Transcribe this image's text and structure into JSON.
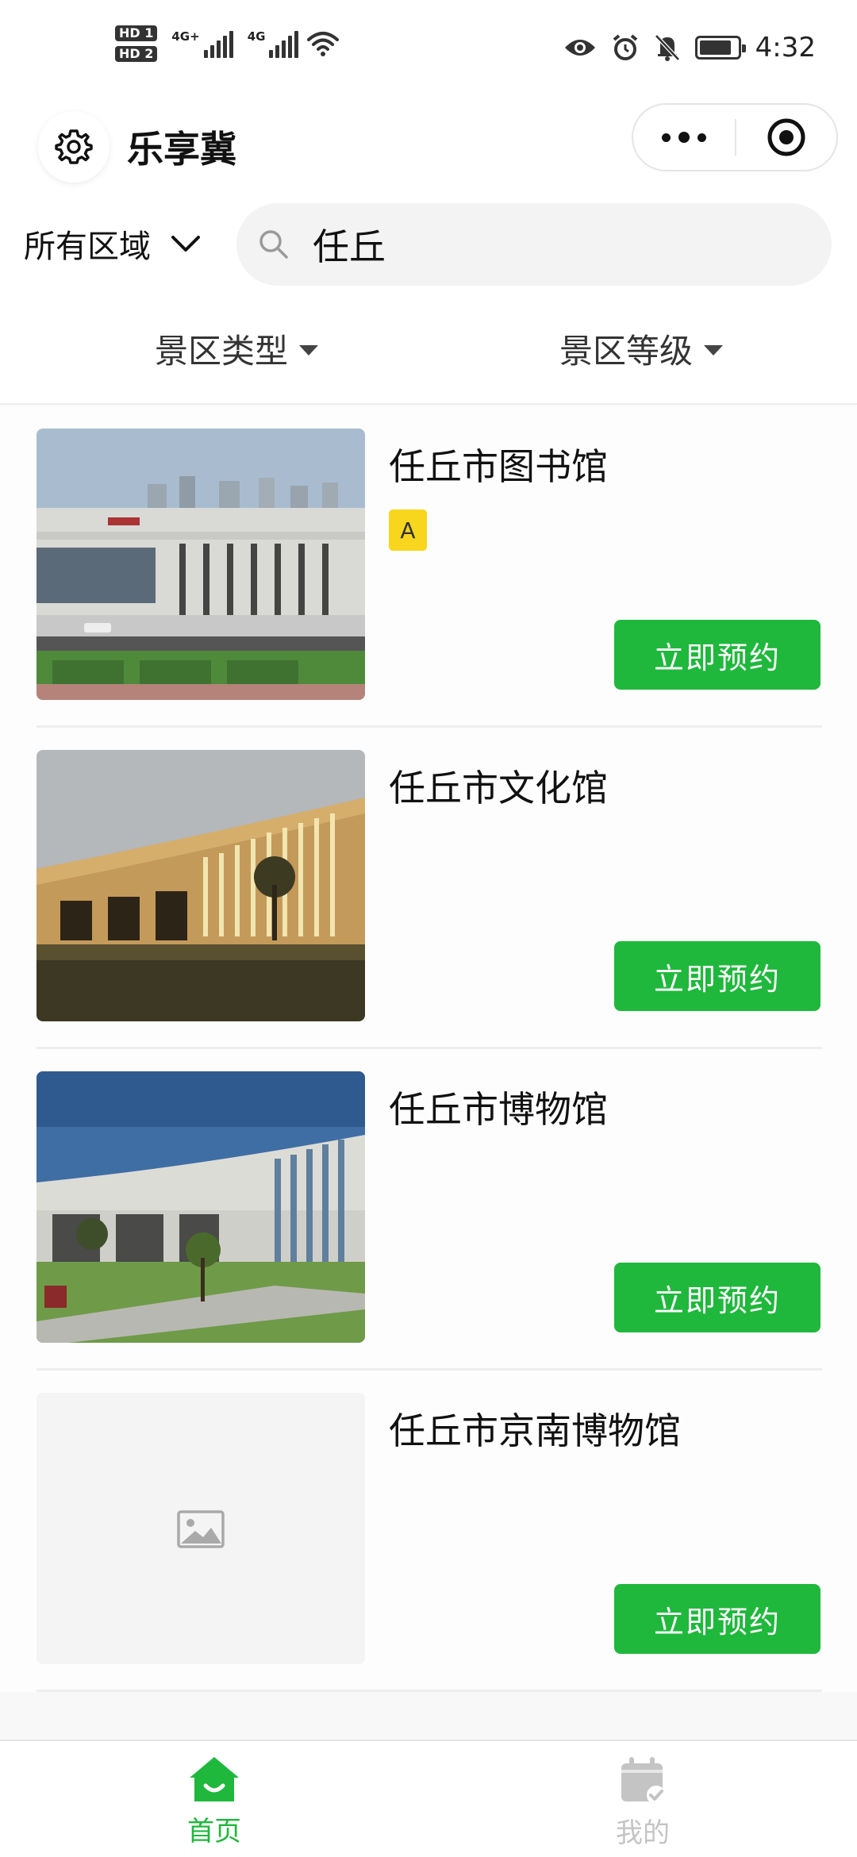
{
  "status_bar": {
    "hd1": "HD 1",
    "hd2": "HD 2",
    "sim1_net": "4G+",
    "sim2_net": "4G",
    "time": "4:32",
    "battery_level": 0.85,
    "icons": [
      "eye-icon",
      "alarm-icon",
      "bell-off-icon",
      "battery-icon"
    ]
  },
  "app": {
    "title": "乐享冀"
  },
  "search": {
    "region_label": "所有区域",
    "query": "任丘"
  },
  "filters": [
    {
      "label": "景区类型"
    },
    {
      "label": "景区等级"
    }
  ],
  "items": [
    {
      "name": "任丘市图书馆",
      "badge": "A",
      "book_label": "立即预约",
      "image": "library-photo"
    },
    {
      "name": "任丘市文化馆",
      "badge": "",
      "book_label": "立即预约",
      "image": "culture-center-photo"
    },
    {
      "name": "任丘市博物馆",
      "badge": "",
      "book_label": "立即预约",
      "image": "museum-photo"
    },
    {
      "name": "任丘市京南博物馆",
      "badge": "",
      "book_label": "立即预约",
      "image": "placeholder"
    }
  ],
  "tabs": [
    {
      "label": "首页",
      "active": true,
      "icon": "home-icon"
    },
    {
      "label": "我的",
      "active": false,
      "icon": "calendar-check-icon"
    }
  ],
  "colors": {
    "accent": "#1fb83c",
    "badge": "#f7d61d",
    "tab_inactive": "#c4c4c4"
  }
}
